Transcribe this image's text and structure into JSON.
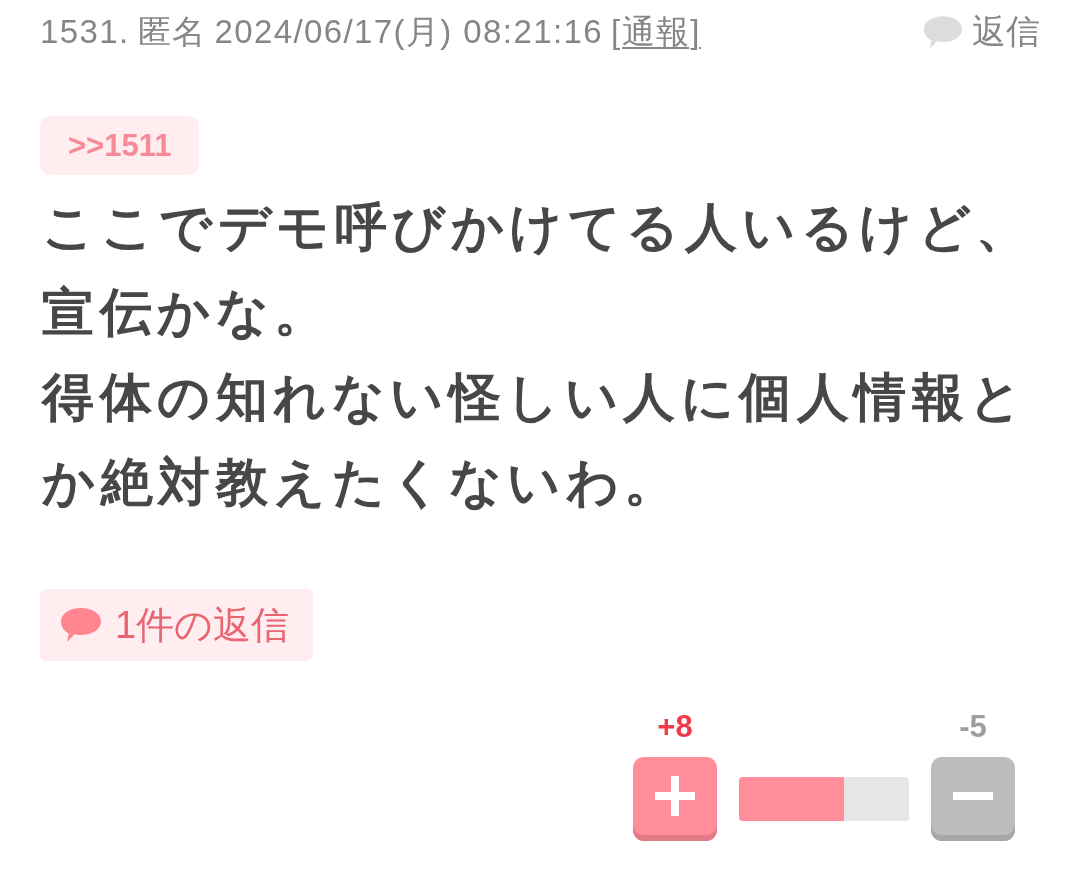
{
  "post": {
    "number": "1531.",
    "author": "匿名",
    "datetime": "2024/06/17(月) 08:21:16",
    "report_link": "[通報]",
    "reply_button": "返信"
  },
  "quote": ">>1511",
  "body": [
    "ここでデモ呼びかけてる人いるけど、宣伝かな。",
    "得体の知れない怪しい人に個人情報とか絶対教えたくないわ。"
  ],
  "reply_count": "1件の返信",
  "votes": {
    "plus": "+8",
    "minus": "-5",
    "level": 0.615
  }
}
